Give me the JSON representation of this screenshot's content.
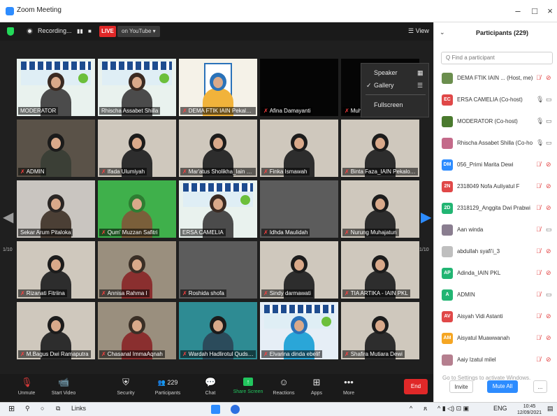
{
  "window": {
    "title": "Zoom Meeting",
    "minimize": "–",
    "restore": "□",
    "close": "×"
  },
  "topbar": {
    "recording_label": "Recording...",
    "pause": "▮▮",
    "stop": "■",
    "live_badge": "LIVE",
    "live_target": "on YouTube ▾",
    "view_label": "☰ View"
  },
  "view_menu": {
    "items": [
      "Speaker",
      "Gallery",
      "Fullscreen"
    ],
    "checked": "✓"
  },
  "gallery": {
    "page_left": "1/10",
    "page_right": "1/10",
    "tiles": [
      {
        "name": "MODERATOR",
        "muted": false,
        "type": "banner-person"
      },
      {
        "name": "Rhischa Assabet Shilla",
        "muted": false,
        "type": "banner-person"
      },
      {
        "name": "DEMA FTIK IAIN Pekalongan",
        "muted": true,
        "type": "poster"
      },
      {
        "name": "Afina Damayanti",
        "muted": true,
        "type": "dark"
      },
      {
        "name": "Muhammad Rizqi Zamzmai",
        "muted": true,
        "type": "dark"
      },
      {
        "name": "ADMIN",
        "muted": true,
        "type": "group"
      },
      {
        "name": "Ifada Ulumiyah",
        "muted": true,
        "type": "person"
      },
      {
        "name": "Mar'atus Sholikha_Iain pek",
        "muted": true,
        "type": "person"
      },
      {
        "name": "Finka Ismawah",
        "muted": true,
        "type": "person"
      },
      {
        "name": "Binta Faza_IAIN Pekalongan",
        "muted": true,
        "type": "person"
      },
      {
        "name": "Sekar Arum Pitaloka",
        "muted": false,
        "type": "cat"
      },
      {
        "name": "Qum' Muzzan Safitri",
        "muted": true,
        "type": "green"
      },
      {
        "name": "ERSA CAMELIA",
        "muted": false,
        "type": "banner-person"
      },
      {
        "name": "Idhda Maulidah",
        "muted": true,
        "type": "blank"
      },
      {
        "name": "Nurung Muhajatun",
        "muted": true,
        "type": "person"
      },
      {
        "name": "Rizanati Fitriina",
        "muted": true,
        "type": "person"
      },
      {
        "name": "Annisa Rahma I",
        "muted": true,
        "type": "room"
      },
      {
        "name": "Roshida shofa",
        "muted": true,
        "type": "blank"
      },
      {
        "name": "Sindy darmawati",
        "muted": true,
        "type": "person"
      },
      {
        "name": "TIA ARTIKA - IAIN PKL",
        "muted": true,
        "type": "person"
      },
      {
        "name": "M.Bagus Dwi Ramaputra",
        "muted": true,
        "type": "person"
      },
      {
        "name": "Chasanal ImmaAqnah",
        "muted": true,
        "type": "room"
      },
      {
        "name": "Wardah Hadlirotul Qudsiyah",
        "muted": true,
        "type": "teal"
      },
      {
        "name": "Elvarina dinda ebelif",
        "muted": true,
        "type": "poster2"
      },
      {
        "name": "Shafira Mutiara Dewi",
        "muted": true,
        "type": "person"
      }
    ]
  },
  "toolbar": {
    "unmute": "Unmute",
    "start_video": "Start Video",
    "security": "Security",
    "participants": "Participants",
    "participants_count": "229",
    "chat": "Chat",
    "share_screen": "Share Screen",
    "reactions": "Reactions",
    "apps": "Apps",
    "more": "More",
    "end": "End"
  },
  "participants_panel": {
    "title": "Participants (229)",
    "search_placeholder": "Q Find a participant",
    "people": [
      {
        "name": "DEMA FTIK IAIN ... (Host, me)",
        "initials": "",
        "color": "#6b8e4e",
        "mic": "off",
        "cam": "off"
      },
      {
        "name": "ERSA CAMELIA (Co-host)",
        "initials": "EC",
        "color": "#e04848",
        "mic": "on",
        "cam": "on"
      },
      {
        "name": "MODERATOR (Co-host)",
        "initials": "",
        "color": "#4a7a2e",
        "mic": "on",
        "cam": "on"
      },
      {
        "name": "Rhischa Assabet Shilla (Co-host)",
        "initials": "",
        "color": "#c46a8a",
        "mic": "on",
        "cam": "on"
      },
      {
        "name": "056_Primi Marita Dewi",
        "initials": "DM",
        "color": "#2d8cff",
        "mic": "off",
        "cam": "off"
      },
      {
        "name": "2318049 Nofa Auliyatul F",
        "initials": "2N",
        "color": "#e04848",
        "mic": "off",
        "cam": "off"
      },
      {
        "name": "2318129_Anggita Dwi Prabwi",
        "initials": "2D",
        "color": "#22b573",
        "mic": "off",
        "cam": "off"
      },
      {
        "name": "Aan winda",
        "initials": "",
        "color": "#8a7e90",
        "mic": "off",
        "cam": "on"
      },
      {
        "name": "abdullah syafi'i_3",
        "initials": "",
        "color": "#bfbfbf",
        "mic": "off",
        "cam": "off"
      },
      {
        "name": "Adinda_IAIN PKL",
        "initials": "AP",
        "color": "#22b573",
        "mic": "off",
        "cam": "off"
      },
      {
        "name": "ADMIN",
        "initials": "A",
        "color": "#22b573",
        "mic": "off",
        "cam": "on"
      },
      {
        "name": "Aisyah Vidi Astanti",
        "initials": "AV",
        "color": "#e04848",
        "mic": "off",
        "cam": "off"
      },
      {
        "name": "Aisyatul Muawwanah",
        "initials": "AM",
        "color": "#f5a623",
        "mic": "off",
        "cam": "off"
      },
      {
        "name": "Aaiy Izatul milel",
        "initials": "",
        "color": "#b57f8f",
        "mic": "off",
        "cam": "off"
      }
    ],
    "activate_text": "Go to Settings to activate Windows.",
    "invite": "Invite",
    "mute_all": "Mute All",
    "more": "..."
  },
  "taskbar": {
    "links": "Links",
    "lang": "ENG",
    "time": "10:45",
    "date": "12/09/2021"
  }
}
